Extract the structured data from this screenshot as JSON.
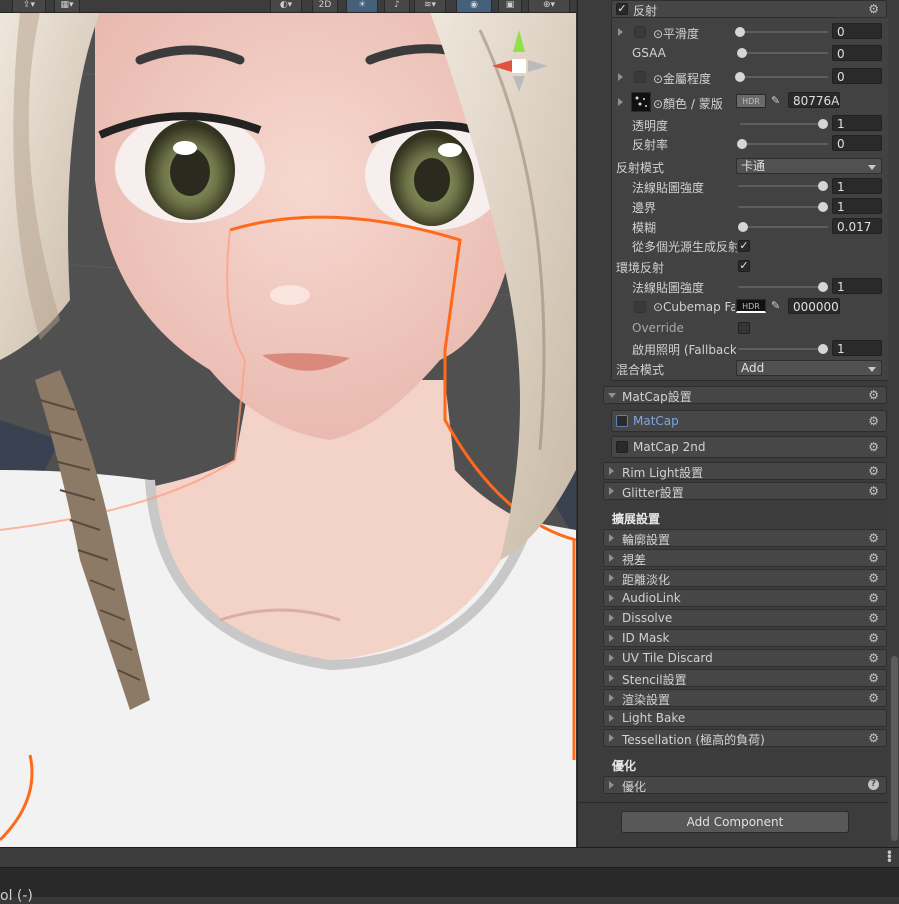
{
  "scene": {
    "toolbar": {
      "mode_2d": "2D"
    }
  },
  "inspector": {
    "reflection": {
      "header": "反射",
      "enabled": true,
      "smoothness": {
        "label": "⊙平滑度",
        "value": "0",
        "fraction": 0
      },
      "gsaa": {
        "label": "GSAA",
        "value": "0",
        "fraction": 0
      },
      "metallic": {
        "label": "⊙金屬程度",
        "value": "0",
        "fraction": 0
      },
      "color_mask": {
        "label": "⊙顏色 / 蒙版",
        "hdr": "HDR",
        "hex": "80776A"
      },
      "transparency": {
        "label": "透明度",
        "value": "1",
        "fraction": 1
      },
      "reflectance": {
        "label": "反射率",
        "value": "0",
        "fraction": 0
      },
      "reflection_mode": {
        "label": "反射模式",
        "value": "卡通"
      },
      "normal_strength": {
        "label": "法線貼圖強度",
        "value": "1",
        "fraction": 1
      },
      "border": {
        "label": "邊界",
        "value": "1",
        "fraction": 1
      },
      "blur": {
        "label": "模糊",
        "value": "0.017",
        "fraction": 0.017
      },
      "multi_light": {
        "label": "從多個光源生成反射",
        "checked": true
      },
      "env_reflection": {
        "label": "環境反射",
        "checked": true
      },
      "env_normal_strength": {
        "label": "法線貼圖強度",
        "value": "1",
        "fraction": 1
      },
      "cubemap": {
        "label": "⊙Cubemap Fallback",
        "hdr": "HDR",
        "hex": "000000"
      },
      "override": {
        "label": "Override",
        "checked": false
      },
      "lighting_fallback": {
        "label": "啟用照明 (Fallback)",
        "value": "1",
        "fraction": 1
      },
      "blend_mode": {
        "label": "混合模式",
        "value": "Add"
      }
    },
    "matcap_section": "MatCap設置",
    "matcap": {
      "label": "MatCap",
      "checked": false
    },
    "matcap2": {
      "label": "MatCap 2nd",
      "checked": false
    },
    "rimlight_section": "Rim Light設置",
    "glitter_section": "Glitter設置",
    "extension_header": "擴展設置",
    "extension_items": [
      "輪廓設置",
      "視差",
      "距離淡化",
      "AudioLink",
      "Dissolve",
      "ID Mask",
      "UV Tile Discard",
      "Stencil設置",
      "渲染設置",
      "Light Bake",
      "Tessellation (極高的負荷)"
    ],
    "optimization_header": "優化",
    "optimization_item": "優化",
    "add_component": "Add Component",
    "colors": {
      "panel": "#3c3c3c",
      "field": "#2a2a2a",
      "accent": "#7ea6e0",
      "selection_outline": "#ff6a1a"
    }
  },
  "bottom": {
    "text": "ol (-)"
  }
}
